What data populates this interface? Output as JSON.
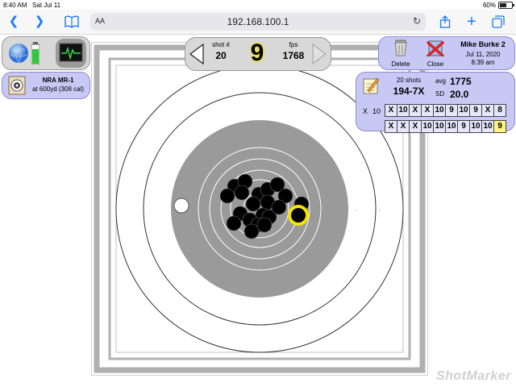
{
  "status_bar": {
    "time": "8:40 AM",
    "date": "Sat Jul 11",
    "battery": "60%",
    "battery_level": 0.6
  },
  "browser": {
    "url": "192.168.100.1",
    "text_size_label": "AA"
  },
  "target_info": {
    "name": "NRA MR-1",
    "detail": "at 600yd (308 cal)"
  },
  "current_shot": {
    "shot_label": "shot #",
    "shot_number": "20",
    "score": "9",
    "fps_label": "fps",
    "fps": "1768"
  },
  "session": {
    "delete_label": "Delete",
    "close_label": "Close",
    "shooter": "Mike Burke 2",
    "date": "Jul 11, 2020",
    "time": "8:39 am"
  },
  "stats": {
    "shots": "20 shots",
    "score": "194-7X",
    "avg_label": "avg",
    "avg": "1775",
    "sd_label": "SD",
    "sd": "20.0",
    "x_label": "X",
    "x_count": "10",
    "row1": [
      "X",
      "10",
      "X",
      "X",
      "10",
      "9",
      "10",
      "9",
      "X",
      "8"
    ],
    "row2": [
      "X",
      "X",
      "X",
      "10",
      "10",
      "10",
      "9",
      "10",
      "10",
      "9"
    ],
    "highlight_last": true
  },
  "watermark": "ShotMarker",
  "colors": {
    "accent": "#1479fb",
    "panel": "#c8c8f5",
    "highlight": "#fff680",
    "current_shot_ring": "#f5e400"
  }
}
